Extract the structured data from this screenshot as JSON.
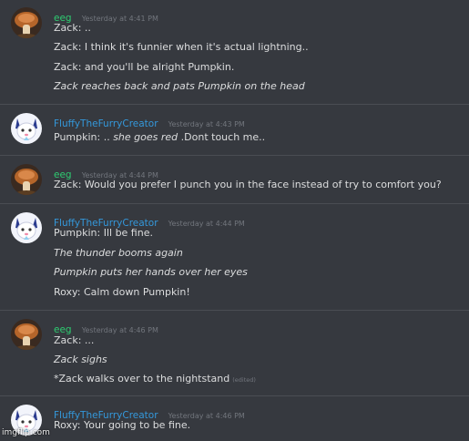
{
  "colors": {
    "background": "#36393f",
    "text": "#dcddde",
    "timestamp": "#72767d",
    "eeg_name": "#2ecc71",
    "fluffy_name": "#3498db"
  },
  "groups": [
    {
      "username": "eeg",
      "timestamp": "Yesterday at 4:41 PM",
      "avatar_icon": "mushroom-avatar-icon",
      "lines": [
        {
          "text": "Zack: ..",
          "italic": false
        },
        {
          "text": "Zack: I think it's funnier when it's actual lightning..",
          "italic": false
        },
        {
          "text": "Zack: and you'll be alright Pumpkin.",
          "italic": false
        },
        {
          "text": "Zack reaches back and pats Pumpkin on the head",
          "italic": true
        }
      ]
    },
    {
      "username": "FluffyTheFurryCreator",
      "timestamp": "Yesterday at 4:43 PM",
      "avatar_icon": "furry-avatar-icon",
      "lines": [
        {
          "prefix": "Pumpkin: .. ",
          "em": "she goes red",
          "suffix": " .Dont touch me.."
        }
      ]
    },
    {
      "username": "eeg",
      "timestamp": "Yesterday at 4:44 PM",
      "avatar_icon": "mushroom-avatar-icon",
      "lines": [
        {
          "text": "Zack: Would you prefer I punch you in the face instead of try to comfort you?",
          "italic": false
        }
      ]
    },
    {
      "username": "FluffyTheFurryCreator",
      "timestamp": "Yesterday at 4:44 PM",
      "avatar_icon": "furry-avatar-icon",
      "lines": [
        {
          "text": "Pumpkin: Ill be fine.",
          "italic": false
        },
        {
          "text": "The thunder booms again",
          "italic": true
        },
        {
          "text": "Pumpkin puts her hands over her eyes",
          "italic": true
        },
        {
          "text": "Roxy: Calm down Pumpkin!",
          "italic": false
        }
      ]
    },
    {
      "username": "eeg",
      "timestamp": "Yesterday at 4:46 PM",
      "avatar_icon": "mushroom-avatar-icon",
      "lines": [
        {
          "text": "Zack: ...",
          "italic": false
        },
        {
          "text": "Zack sighs",
          "italic": true
        },
        {
          "text": "*Zack walks over to the nightstand",
          "italic": false,
          "edited": "(edited)"
        }
      ]
    },
    {
      "username": "FluffyTheFurryCreator",
      "timestamp": "Yesterday at 4:46 PM",
      "avatar_icon": "furry-avatar-icon",
      "lines": [
        {
          "text": "Roxy: Your going to be fine.",
          "italic": false
        }
      ]
    }
  ],
  "watermark": "imgflip.com"
}
